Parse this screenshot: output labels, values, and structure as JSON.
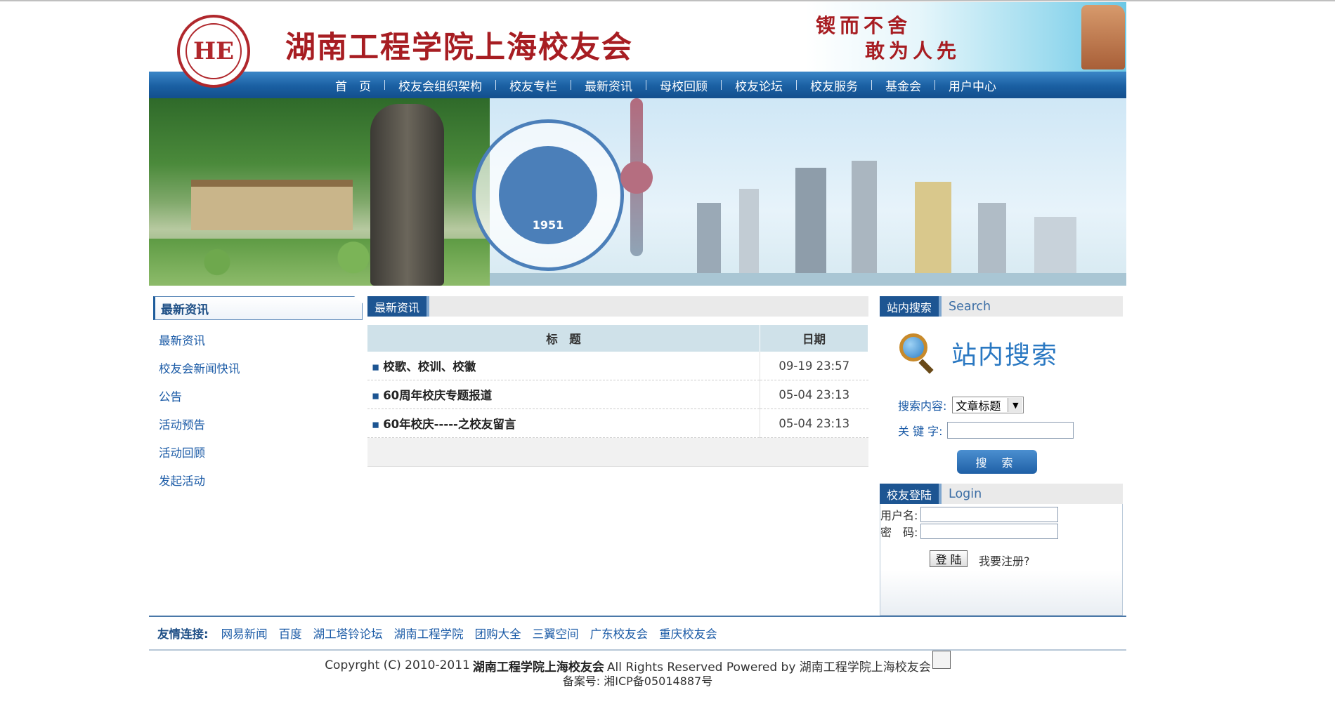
{
  "header": {
    "site_title": "湖南工程学院上海校友会",
    "slogan_line1": "锲而不舍",
    "slogan_line2": "敢为人先"
  },
  "nav": {
    "items": [
      {
        "label": "首　页"
      },
      {
        "label": "校友会组织架构"
      },
      {
        "label": "校友专栏"
      },
      {
        "label": "最新资讯"
      },
      {
        "label": "母校回顾"
      },
      {
        "label": "校友论坛"
      },
      {
        "label": "校友服务"
      },
      {
        "label": "基金会"
      },
      {
        "label": "用户中心"
      }
    ]
  },
  "banner": {
    "emblem_text": "1951"
  },
  "left_sidebar": {
    "title": "最新资讯",
    "items": [
      {
        "label": "最新资讯"
      },
      {
        "label": "校友会新闻快讯"
      },
      {
        "label": "公告"
      },
      {
        "label": "活动预告"
      },
      {
        "label": "活动回顾"
      },
      {
        "label": "发起活动"
      }
    ]
  },
  "news": {
    "title": "最新资讯",
    "columns": {
      "title": "标　题",
      "date": "日期"
    },
    "rows": [
      {
        "title": "校歌、校训、校徽",
        "date": "09-19 23:57"
      },
      {
        "title": "60周年校庆专题报道",
        "date": "05-04 23:13"
      },
      {
        "title": "60年校庆-----之校友留言",
        "date": "05-04 23:13"
      }
    ]
  },
  "search": {
    "tab_label": "站内搜索",
    "tab_en": "Search",
    "heading": "站内搜索",
    "content_label": "搜索内容:",
    "content_selected": "文章标题",
    "keyword_label": "关 键 字:",
    "keyword_value": "",
    "button": "搜 索"
  },
  "login": {
    "tab_label": "校友登陆",
    "tab_en": "Login",
    "username_label": "用户名:",
    "password_label": "密　码:",
    "login_button": "登 陆",
    "register_link": "我要注册?"
  },
  "friend_links": {
    "label": "友情连接:",
    "items": [
      {
        "label": "网易新闻"
      },
      {
        "label": "百度"
      },
      {
        "label": "湖工塔铃论坛"
      },
      {
        "label": "湖南工程学院"
      },
      {
        "label": "团购大全"
      },
      {
        "label": "三翼空间"
      },
      {
        "label": "广东校友会"
      },
      {
        "label": "重庆校友会"
      }
    ]
  },
  "footer": {
    "copyright_prefix": "Copyrght (C) 2010-2011",
    "copyright_org": "湖南工程学院上海校友会",
    "copyright_suffix": "All Rights Reserved Powered by 湖南工程学院上海校友会",
    "icp": "备案号: 湘ICP备05014887号"
  },
  "colors": {
    "brand_red": "#a71d22",
    "nav_blue": "#1a5fa2",
    "link_blue": "#1a5aa6"
  }
}
